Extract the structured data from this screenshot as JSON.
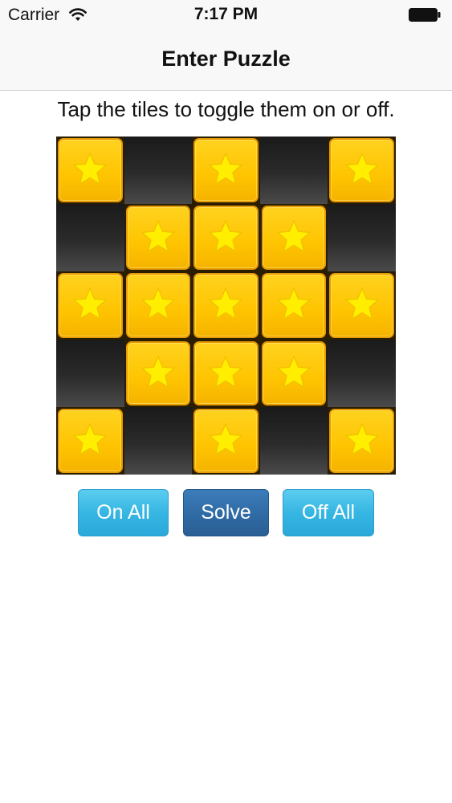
{
  "status_bar": {
    "carrier": "Carrier",
    "time": "7:17 PM",
    "wifi_icon": "wifi-icon",
    "battery_icon": "battery-icon"
  },
  "nav": {
    "title": "Enter Puzzle"
  },
  "instructions": "Tap the tiles to toggle them on or off.",
  "puzzle": {
    "rows": 5,
    "cols": 5,
    "tile_icon": "star-icon",
    "grid": [
      [
        1,
        0,
        1,
        0,
        1
      ],
      [
        0,
        1,
        1,
        1,
        0
      ],
      [
        1,
        1,
        1,
        1,
        1
      ],
      [
        0,
        1,
        1,
        1,
        0
      ],
      [
        1,
        0,
        1,
        0,
        1
      ]
    ]
  },
  "buttons": {
    "on_all": "On All",
    "solve": "Solve",
    "off_all": "Off All"
  },
  "colors": {
    "tile_on": "#ffc400",
    "tile_on_border": "#e59a00",
    "star": "#ffee00",
    "tile_off": "#2b2b2b",
    "button_light": "#36b6e2",
    "button_dark": "#2f6aa4"
  }
}
